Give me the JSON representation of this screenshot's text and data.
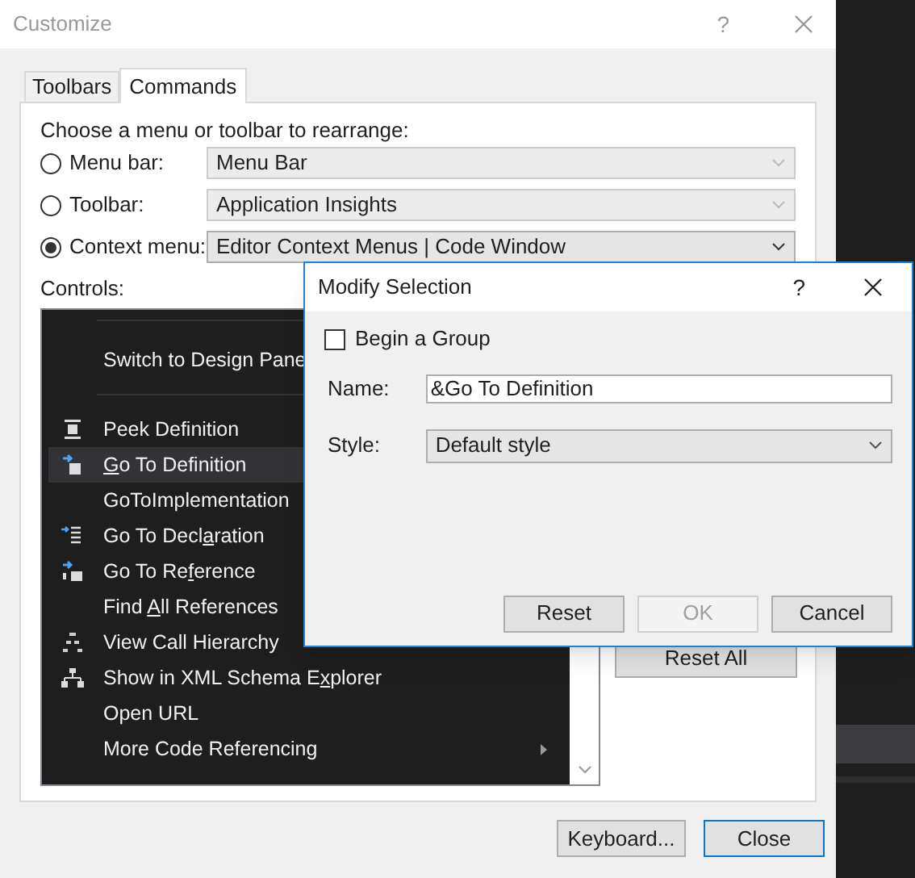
{
  "window": {
    "title": "Customize",
    "help": "?"
  },
  "tabs": [
    {
      "label": "Toolbars",
      "selected": false
    },
    {
      "label": "Commands",
      "selected": true
    }
  ],
  "prompt": "Choose a menu or toolbar to rearrange:",
  "targets": [
    {
      "label": "Menu bar:",
      "selected": false,
      "value": "Menu Bar",
      "disabled": true
    },
    {
      "label": "Toolbar:",
      "selected": false,
      "value": "Application Insights",
      "disabled": true
    },
    {
      "label": "Context menu:",
      "selected": true,
      "value": "Editor Context Menus | Code Window",
      "disabled": false
    }
  ],
  "controls_label": "Controls:",
  "controls": [
    {
      "kind": "separator"
    },
    {
      "kind": "plain",
      "label": {
        "pre": "Switch to Design Pane"
      },
      "selected": false
    },
    {
      "kind": "separator"
    },
    {
      "kind": "peek",
      "label": {
        "pre": "Peek Definition"
      },
      "selected": false
    },
    {
      "kind": "definition",
      "label": {
        "key": "G",
        "post": "o To Definition"
      },
      "selected": true
    },
    {
      "kind": "plain",
      "label": {
        "pre": "GoToImplementation"
      },
      "selected": false
    },
    {
      "kind": "declaration",
      "label": {
        "pre": "Go To Decl",
        "key": "a",
        "post": "ration"
      },
      "selected": false
    },
    {
      "kind": "reference",
      "label": {
        "pre": "Go To Re",
        "key": "f",
        "post": "erence"
      },
      "selected": false
    },
    {
      "kind": "plain",
      "label": {
        "pre": "Find ",
        "key": "A",
        "post": "ll References"
      },
      "selected": false
    },
    {
      "kind": "hierarchy",
      "label": {
        "pre": "View Call Hierarchy"
      },
      "selected": false
    },
    {
      "kind": "schema",
      "label": {
        "pre": "Show in XML Schema E",
        "key": "x",
        "post": "plorer"
      },
      "selected": false
    },
    {
      "kind": "plain",
      "label": {
        "pre": "Open URL"
      },
      "selected": false
    },
    {
      "kind": "submenu",
      "label": {
        "pre": "More Code Referencing"
      },
      "selected": false
    }
  ],
  "side_buttons": [
    "Reset All"
  ],
  "footer_buttons": [
    {
      "label": "Keyboard...",
      "default": false
    },
    {
      "label": "Close",
      "default": true
    }
  ],
  "dialog": {
    "title": "Modify Selection",
    "help": "?",
    "begin_group": {
      "label": "Begin a Group",
      "checked": false
    },
    "name": {
      "label": "Name:",
      "value": "&Go To Definition"
    },
    "style": {
      "label": "Style:",
      "value": "Default style"
    },
    "buttons": [
      {
        "label": "Reset",
        "disabled": false
      },
      {
        "label": "OK",
        "disabled": true
      },
      {
        "label": "Cancel",
        "disabled": false
      }
    ]
  }
}
